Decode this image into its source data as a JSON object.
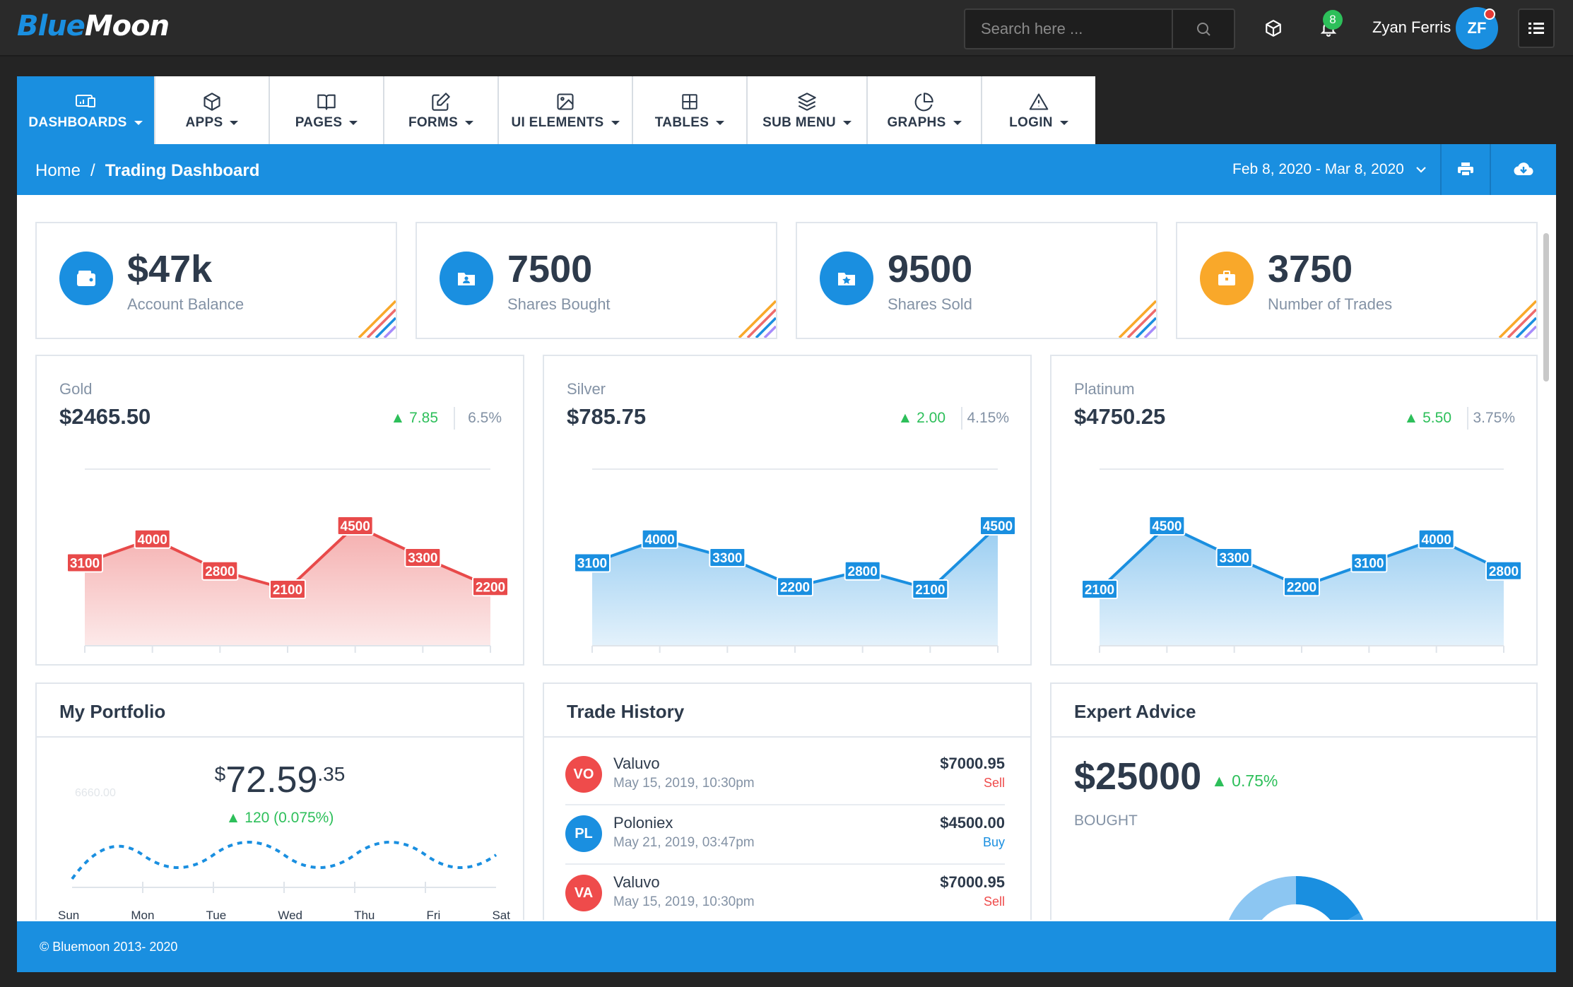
{
  "brand": {
    "logo_part1": "Blue",
    "logo_part2": "Moon"
  },
  "topbar": {
    "search_placeholder": "Search here ...",
    "notification_count": "8",
    "user_name": "Zyan Ferris",
    "user_initials": "ZF"
  },
  "nav": {
    "tabs": [
      {
        "label": "DASHBOARDS",
        "icon": "dashboard-icon",
        "active": true
      },
      {
        "label": "APPS",
        "icon": "box-icon"
      },
      {
        "label": "PAGES",
        "icon": "book-icon"
      },
      {
        "label": "FORMS",
        "icon": "edit-icon"
      },
      {
        "label": "UI ELEMENTS",
        "icon": "image-icon"
      },
      {
        "label": "TABLES",
        "icon": "grid-icon"
      },
      {
        "label": "SUB MENU",
        "icon": "layers-icon"
      },
      {
        "label": "GRAPHS",
        "icon": "pie-chart-icon"
      },
      {
        "label": "LOGIN",
        "icon": "alert-triangle-icon"
      }
    ]
  },
  "breadcrumb": {
    "home": "Home",
    "separator": "/",
    "current": "Trading Dashboard"
  },
  "date_range": "Feb 8, 2020 - Mar 8, 2020",
  "stats": [
    {
      "value": "$47k",
      "label": "Account Balance",
      "icon": "wallet-icon",
      "color": "#1a8fe0"
    },
    {
      "value": "7500",
      "label": "Shares Bought",
      "icon": "id-card-icon",
      "color": "#1a8fe0"
    },
    {
      "value": "9500",
      "label": "Shares Sold",
      "icon": "star-folder-icon",
      "color": "#1a8fe0"
    },
    {
      "value": "3750",
      "label": "Number of Trades",
      "icon": "briefcase-icon",
      "color": "#f9a82a"
    }
  ],
  "metals": [
    {
      "name": "Gold",
      "price": "$2465.50",
      "change": "7.85",
      "percent": "6.5%",
      "color": "#e84a4a"
    },
    {
      "name": "Silver",
      "price": "$785.75",
      "change": "2.00",
      "percent": "4.15%",
      "color": "#1a8fe0"
    },
    {
      "name": "Platinum",
      "price": "$4750.25",
      "change": "5.50",
      "percent": "3.75%",
      "color": "#1a8fe0"
    }
  ],
  "chart_data": [
    {
      "type": "area",
      "series": [
        {
          "values": [
            3100,
            4000,
            2800,
            2100,
            4500,
            3300,
            2200
          ]
        }
      ]
    },
    {
      "type": "area",
      "series": [
        {
          "values": [
            3100,
            4000,
            3300,
            2200,
            2800,
            2100,
            4500
          ]
        }
      ]
    },
    {
      "type": "area",
      "series": [
        {
          "values": [
            2100,
            4500,
            3300,
            2200,
            3100,
            4000,
            2800
          ]
        }
      ]
    }
  ],
  "portfolio": {
    "title": "My Portfolio",
    "currency": "$",
    "amount": "72.59",
    "cents": ".35",
    "change": "120 (0.075%)",
    "ghost_value": "6660.00",
    "days": [
      "Sun",
      "Mon",
      "Tue",
      "Wed",
      "Thu",
      "Fri",
      "Sat"
    ]
  },
  "trade_history": {
    "title": "Trade History",
    "items": [
      {
        "initials": "VO",
        "name": "Valuvo",
        "date": "May 15, 2019, 10:30pm",
        "amount": "$7000.95",
        "type": "Sell",
        "avatar_color": "#ef4b4b",
        "type_color": "#ef4b4b"
      },
      {
        "initials": "PL",
        "name": "Poloniex",
        "date": "May 21, 2019, 03:47pm",
        "amount": "$4500.00",
        "type": "Buy",
        "avatar_color": "#1a8fe0",
        "type_color": "#1a8fe0"
      },
      {
        "initials": "VA",
        "name": "Valuvo",
        "date": "May 15, 2019, 10:30pm",
        "amount": "$7000.95",
        "type": "Sell",
        "avatar_color": "#ef4b4b",
        "type_color": "#ef4b4b"
      }
    ]
  },
  "expert_advice": {
    "title": "Expert Advice",
    "value": "$25000",
    "change": "0.75%",
    "label": "BOUGHT"
  },
  "footer": {
    "copyright": "© Bluemoon 2013- 2020"
  }
}
